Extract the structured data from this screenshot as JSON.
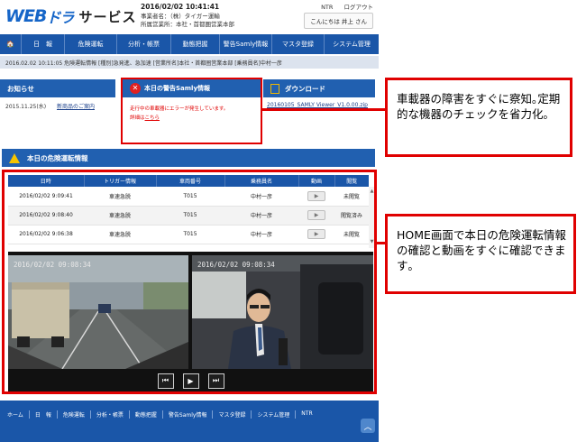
{
  "header": {
    "logo_web": "WEB",
    "logo_dora": "ドラ",
    "logo_service": "サービス",
    "datetime": "2016/02/02 10:41:41",
    "office_line": "事業者名：（株）タイガー運輸",
    "branch_line": "所属営業所：本社・首都圏営業本部",
    "link_ntr": "NTR",
    "link_logout": "ログアウト",
    "greeting": "こんにちは 井上 さん"
  },
  "nav": {
    "items": [
      "🏠",
      "日　報",
      "危険運転",
      "分析・帳票",
      "動態把握",
      "警告Samly情報",
      "マスタ登録",
      "システム管理"
    ]
  },
  "news_ticker": "2016.02.02 10:11:05 危険運転情報 [種別]急発進、急加速 [営業所名]本社・首都圏営業本部 [乗務員名]中村一彦",
  "announcements": {
    "title": "お知らせ",
    "date": "2015.11.25(水)",
    "link": "新商品のご案内"
  },
  "warning": {
    "title": "本日の警告Samly情報",
    "message": "走行中の車載器にエラーが発生しています。",
    "detail_prefix": "詳細は",
    "detail_link": "こちら"
  },
  "download": {
    "title": "ダウンロード",
    "file": "20160105_SAMLY Viewer_V1.0.00.zip"
  },
  "danger": {
    "title": "本日の危険運転情報",
    "columns": [
      "日時",
      "トリガー情報",
      "車両番号",
      "乗務員名",
      "動画",
      "閲覧"
    ],
    "rows": [
      [
        "2016/02/02 9:09:41",
        "車速急脱",
        "T015",
        "中村一彦",
        "▶",
        "未閲覧"
      ],
      [
        "2016/02/02 9:08:40",
        "車速急脱",
        "T015",
        "中村一彦",
        "▶",
        "閲覧済み"
      ],
      [
        "2016/02/02 9:06:38",
        "車速急脱",
        "T015",
        "中村一彦",
        "▶",
        "未閲覧"
      ]
    ]
  },
  "video": {
    "front_timestamp": "2016/02/02 09:08:34",
    "cabin_timestamp": "2016/02/02 09:08:34",
    "controls": [
      "⏮",
      "▶",
      "⏭"
    ]
  },
  "footer": {
    "items": [
      "ホーム",
      "日　報",
      "危険運転",
      "分析・帳票",
      "動態把握",
      "警告Samly情報",
      "マスタ登録",
      "システム管理",
      "NTR"
    ],
    "top_button": "︿"
  },
  "callouts": {
    "first": "車載器の障害をすぐに察知｡定期的な機器のチェックを省力化｡",
    "second": "HOME画面で本日の危険運転情報の確認と動画をすぐに確認できます｡"
  }
}
